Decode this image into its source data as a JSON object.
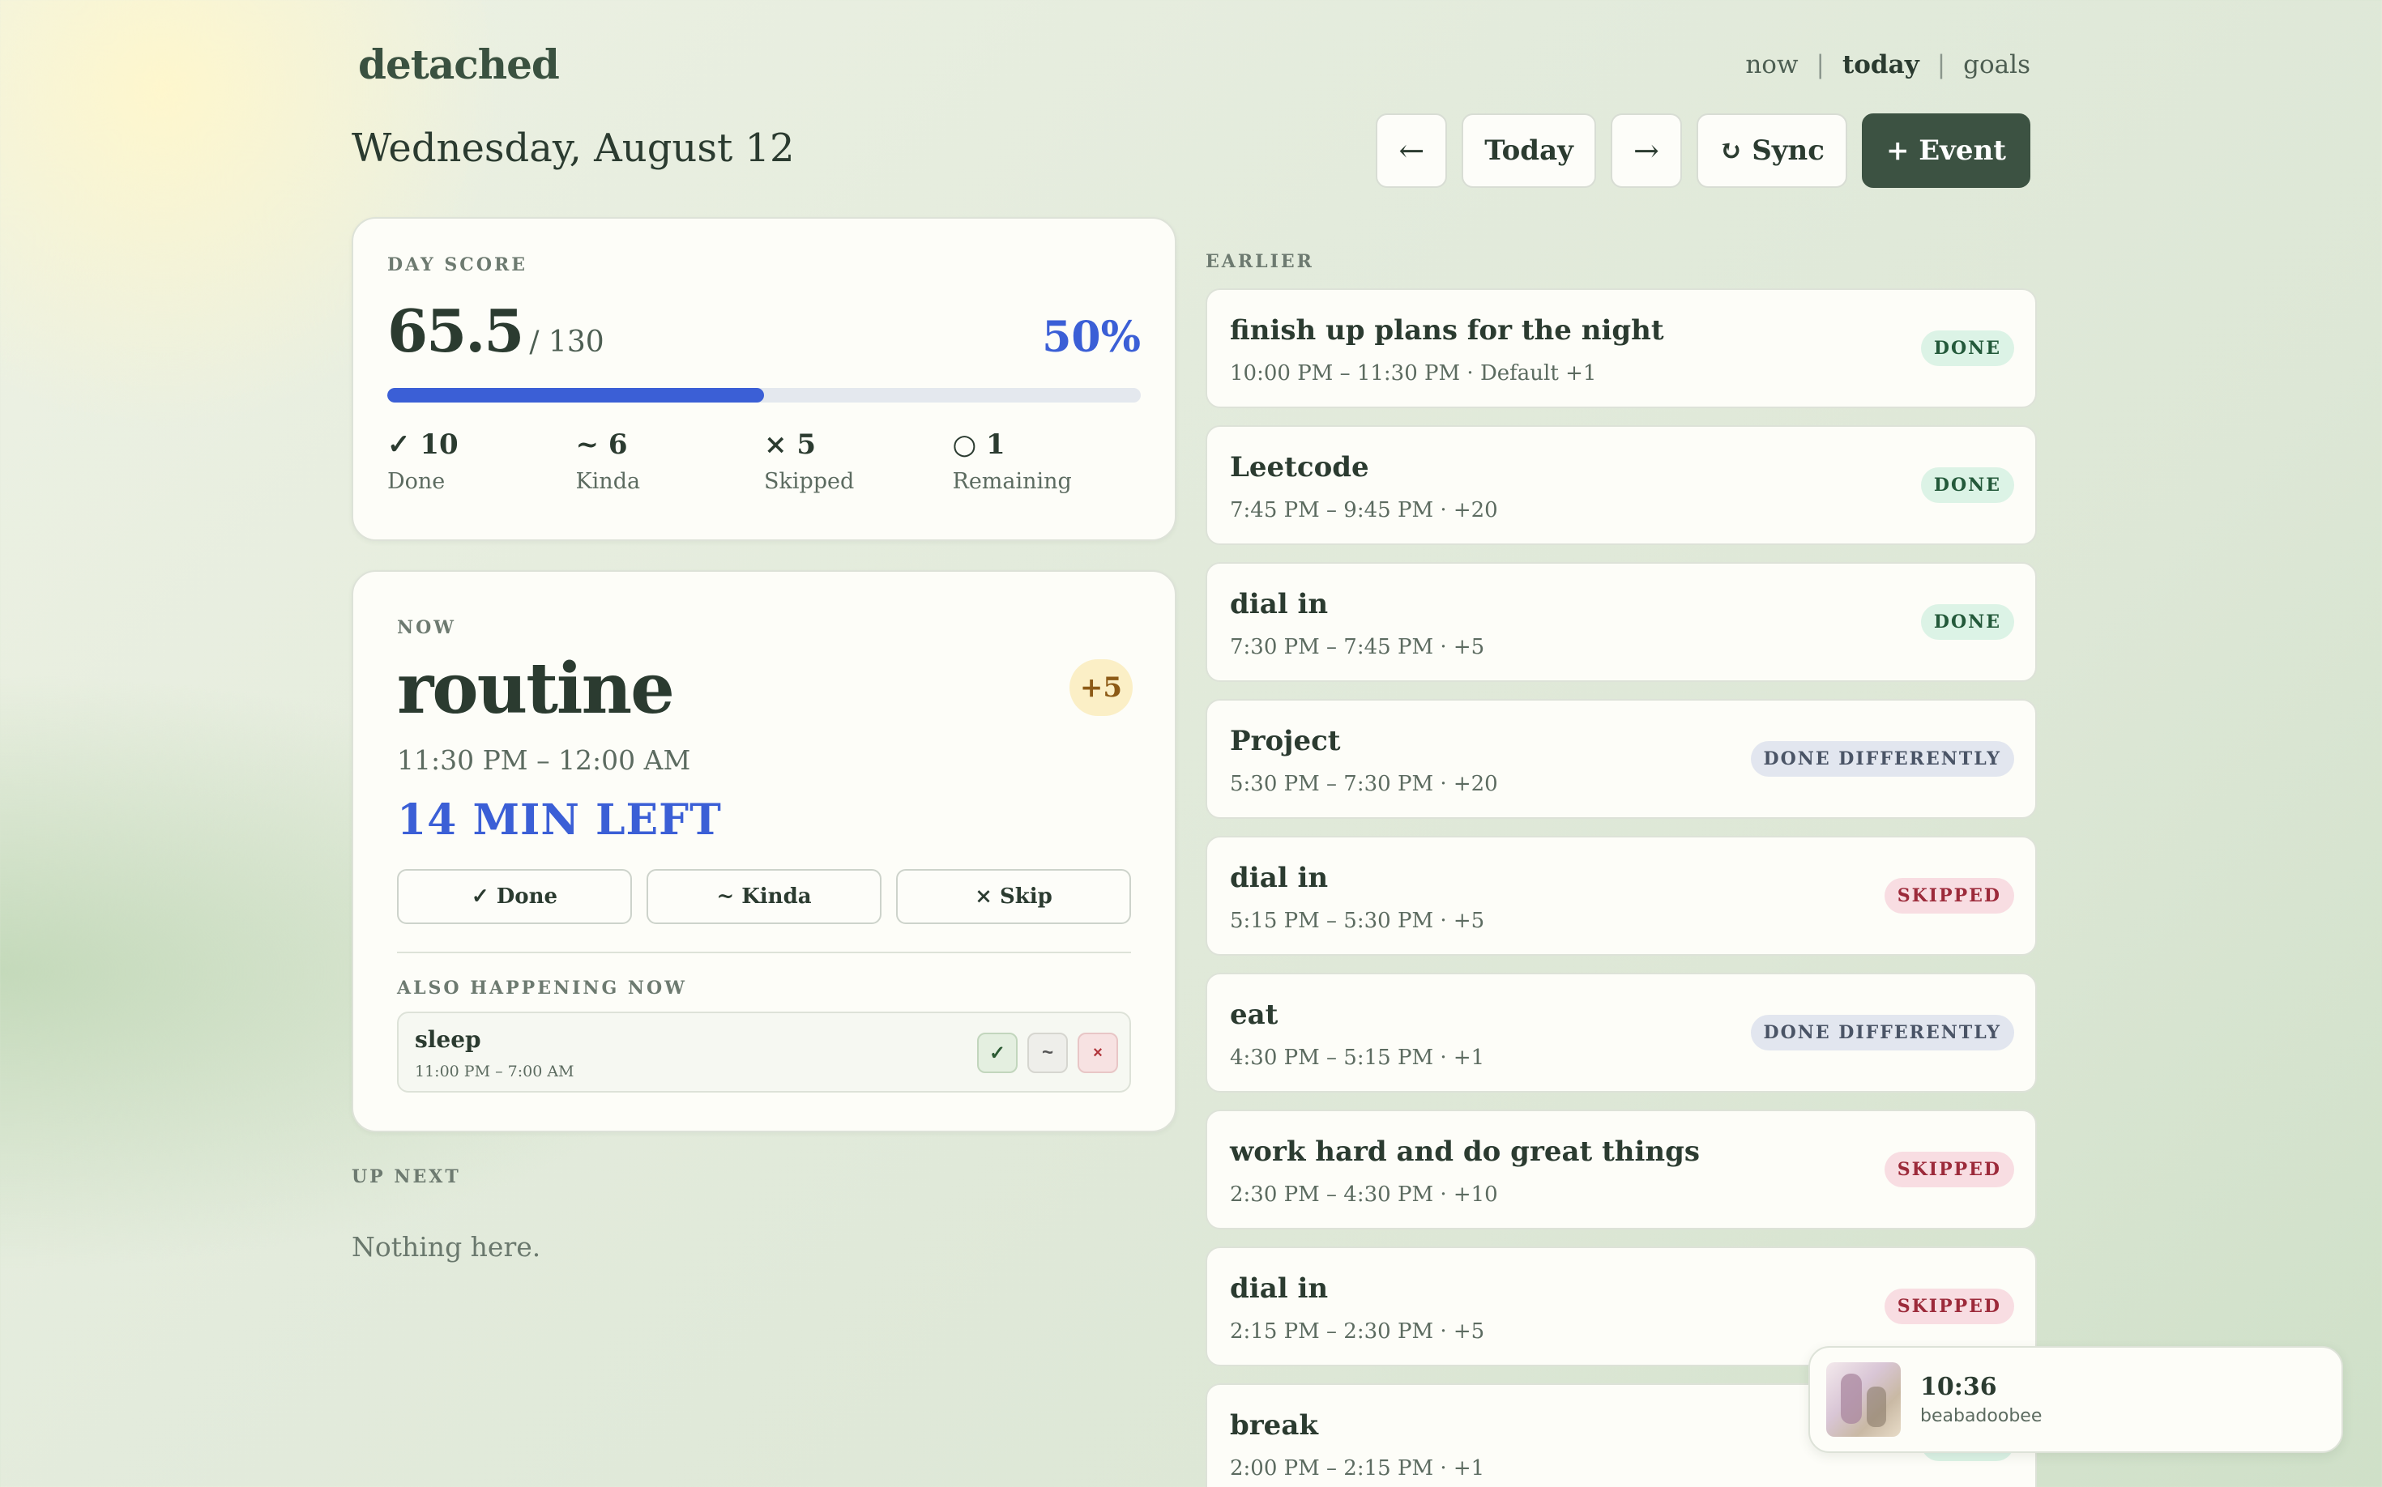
{
  "app": {
    "brand": "detached"
  },
  "nav": {
    "now": "now",
    "today": "today",
    "goals": "goals",
    "separator": "|"
  },
  "header": {
    "date": "Wednesday, August 12",
    "prev": "←",
    "today_btn": "Today",
    "next": "→",
    "sync": "↻ Sync",
    "add_event": "+ Event"
  },
  "day_score": {
    "label": "DAY SCORE",
    "score": "65.5",
    "of": "/ 130",
    "percent_label": "50%",
    "progress_fraction": 0.5,
    "stats": [
      {
        "value": "✓ 10",
        "label": "Done"
      },
      {
        "value": "~ 6",
        "label": "Kinda"
      },
      {
        "value": "× 5",
        "label": "Skipped"
      },
      {
        "value": "○ 1",
        "label": "Remaining"
      }
    ]
  },
  "now": {
    "label": "NOW",
    "title": "routine",
    "points": "+5",
    "time": "11:30 PM – 12:00 AM",
    "left": "14 MIN LEFT",
    "actions": {
      "done": "✓ Done",
      "kinda": "~ Kinda",
      "skip": "× Skip"
    },
    "also_label": "ALSO HAPPENING NOW",
    "also": {
      "name": "sleep",
      "time": "11:00 PM – 7:00 AM",
      "ok": "✓",
      "kinda": "~",
      "no": "×"
    }
  },
  "up_next": {
    "label": "UP NEXT",
    "empty": "Nothing here."
  },
  "earlier": {
    "label": "EARLIER",
    "events": [
      {
        "title": "finish up plans for the night",
        "meta": "10:00 PM – 11:30 PM · Default +1",
        "status": "DONE",
        "kind": "done"
      },
      {
        "title": "Leetcode",
        "meta": "7:45 PM – 9:45 PM · +20",
        "status": "DONE",
        "kind": "done"
      },
      {
        "title": "dial in",
        "meta": "7:30 PM – 7:45 PM · +5",
        "status": "DONE",
        "kind": "done"
      },
      {
        "title": "Project",
        "meta": "5:30 PM – 7:30 PM · +20",
        "status": "DONE DIFFERENTLY",
        "kind": "diff"
      },
      {
        "title": "dial in",
        "meta": "5:15 PM – 5:30 PM · +5",
        "status": "SKIPPED",
        "kind": "skip"
      },
      {
        "title": "eat",
        "meta": "4:30 PM – 5:15 PM · +1",
        "status": "DONE DIFFERENTLY",
        "kind": "diff"
      },
      {
        "title": "work hard and do great things",
        "meta": "2:30 PM – 4:30 PM · +10",
        "status": "SKIPPED",
        "kind": "skip"
      },
      {
        "title": "dial in",
        "meta": "2:15 PM – 2:30 PM · +5",
        "status": "SKIPPED",
        "kind": "skip"
      },
      {
        "title": "break",
        "meta": "2:00 PM – 2:15 PM · +1",
        "status": "DONE",
        "kind": "done"
      }
    ]
  },
  "player": {
    "time": "10:36",
    "artist": "beabadoobee"
  },
  "colors": {
    "accent": "#3b5fd6",
    "primary": "#3c5242",
    "done": "#dcf3e6",
    "diff": "#e2e6ef",
    "skip": "#f8dde2"
  }
}
